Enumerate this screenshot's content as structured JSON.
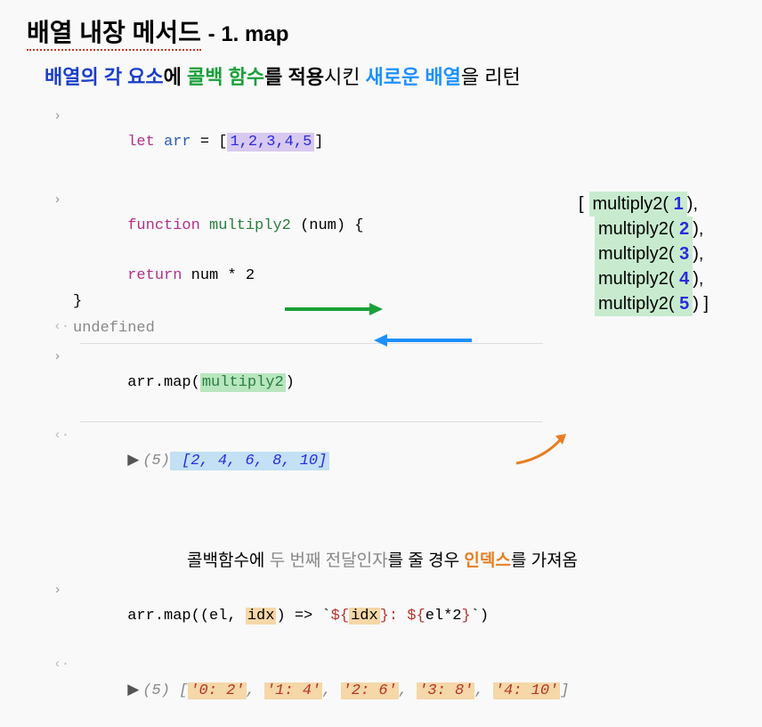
{
  "title": {
    "main": "배열 내장 메서드",
    "sub": "- 1. map"
  },
  "subtitle": {
    "p1": "배열의 각 요소",
    "p2": "에 ",
    "p3": "콜백 함수",
    "p4": "를 적용",
    "p5": "시킨 ",
    "p6": "새로운 배열",
    "p7": "을 리턴"
  },
  "code": {
    "line1": {
      "let": "let",
      "var": "arr",
      "eq": " = ",
      "open": "[",
      "nums": "1,2,3,4,5",
      "close": "]"
    },
    "line2": {
      "func": "function",
      "name": " multiply2 ",
      "params": "(num) {"
    },
    "line3": {
      "indent": "      ",
      "ret": "return",
      "body": " num * 2"
    },
    "line4": {
      "brace": "}"
    },
    "line5": {
      "undef": "undefined"
    },
    "line6": {
      "obj": "arr.",
      "method": "map",
      "open": "(",
      "arg": "multiply2",
      "close": ")"
    },
    "line7": {
      "tri": "▶",
      "count": "(5)",
      "result": " [2, 4, 6, 8, 10]"
    }
  },
  "visual": {
    "r1a": "multiply2(",
    "r1n": " 1 ",
    "r1b": "),",
    "r2a": "multiply2(",
    "r2n": " 2 ",
    "r2b": "),",
    "r3a": "multiply2(",
    "r3n": " 3 ",
    "r3b": "),",
    "r4a": "multiply2(",
    "r4n": " 4 ",
    "r4b": "),",
    "r5a": "multiply2(",
    "r5n": " 5 ",
    "r5b": ")  ]",
    "open": "["
  },
  "note": {
    "p1": "콜백함수에 ",
    "p2": "두 번째 전달인자",
    "p3": "를 줄 경우 ",
    "p4": "인덱스",
    "p5": "를 가져옴"
  },
  "code2": {
    "line1": {
      "pre": "arr.map((el, ",
      "idx": "idx",
      "mid1": ") => `",
      "t1": "${",
      "t2": "idx",
      "t3": "}",
      "mid2": ": ",
      "t4": "${",
      "t5": "el*2",
      "t6": "}",
      "end": "`)"
    },
    "line2": {
      "tri": "▶",
      "count": "(5)",
      "open": " [",
      "s1": "'0: 2'",
      "c": ", ",
      "s2": "'1: 4'",
      "s3": "'2: 6'",
      "s4": "'3: 8'",
      "s5": "'4: 10'",
      "close": "]"
    }
  }
}
